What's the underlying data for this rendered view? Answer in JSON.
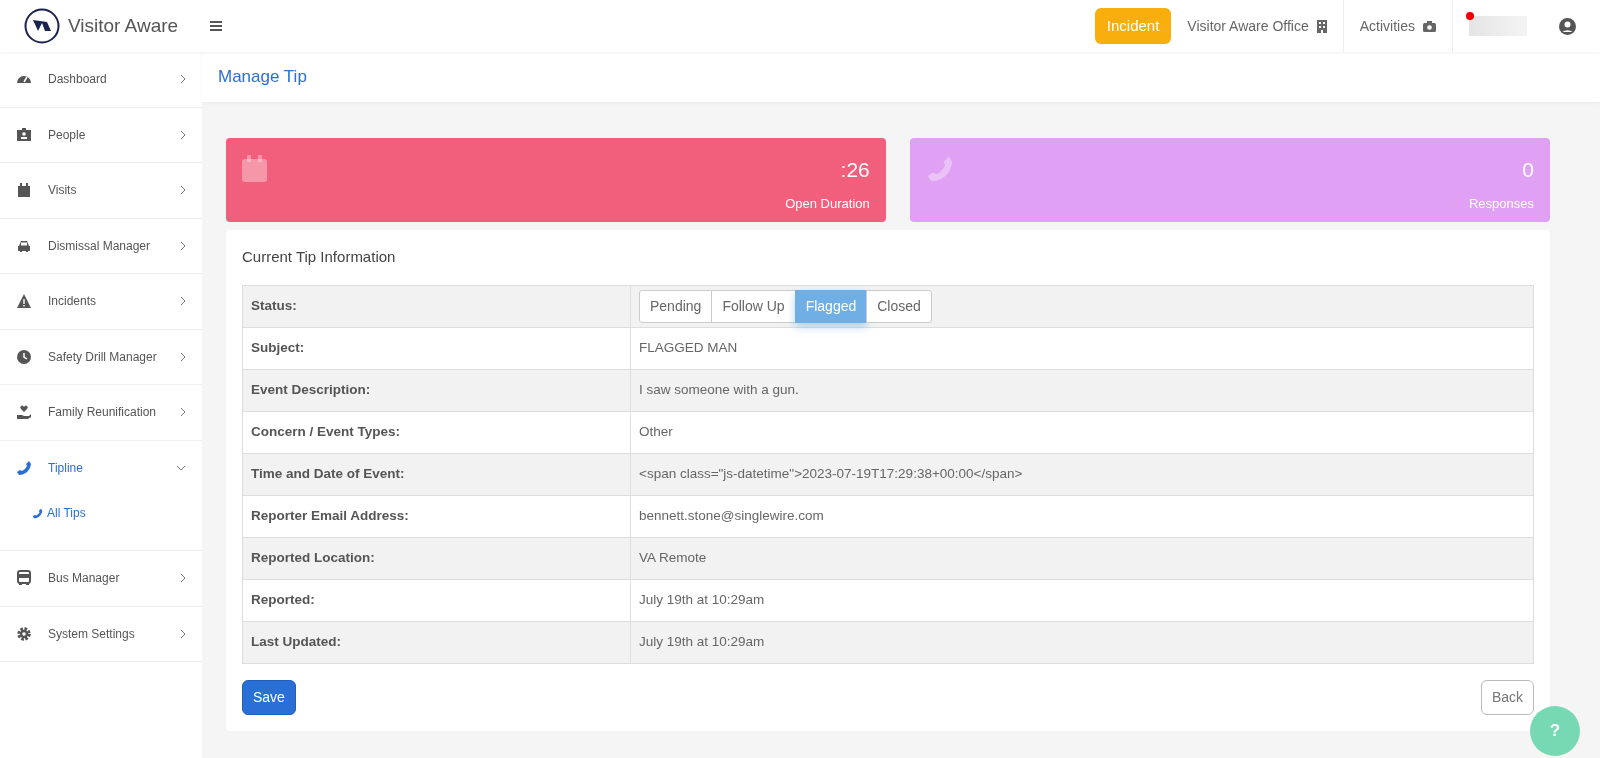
{
  "header": {
    "brand": "Visitor Aware",
    "incident_button": "Incident",
    "office": "Visitor Aware Office",
    "activities": "Activities",
    "notification": true
  },
  "sidebar": {
    "items": [
      {
        "label": "Dashboard",
        "expanded": false,
        "selected": false
      },
      {
        "label": "People",
        "expanded": false,
        "selected": false
      },
      {
        "label": "Visits",
        "expanded": false,
        "selected": false
      },
      {
        "label": "Dismissal Manager",
        "expanded": false,
        "selected": false
      },
      {
        "label": "Incidents",
        "expanded": false,
        "selected": false
      },
      {
        "label": "Safety Drill Manager",
        "expanded": false,
        "selected": false
      },
      {
        "label": "Family Reunification",
        "expanded": false,
        "selected": false
      },
      {
        "label": "Tipline",
        "expanded": true,
        "selected": true,
        "children": [
          {
            "label": "All Tips",
            "selected": true
          }
        ]
      },
      {
        "label": "Bus Manager",
        "expanded": false,
        "selected": false
      },
      {
        "label": "System Settings",
        "expanded": false,
        "selected": false
      }
    ]
  },
  "page_title": "Manage Tip",
  "stats": [
    {
      "value": ":26",
      "label": "Open Duration",
      "color": "#f25f7c"
    },
    {
      "value": "0",
      "label": "Responses",
      "color": "#e0a1f5"
    }
  ],
  "panel": {
    "title": "Current Tip Information",
    "rows": [
      {
        "kind": "status",
        "label": "Status:",
        "options": [
          {
            "label": "Pending",
            "selected": false
          },
          {
            "label": "Follow Up",
            "selected": false
          },
          {
            "label": "Flagged",
            "selected": true
          },
          {
            "label": "Closed",
            "selected": false
          }
        ]
      },
      {
        "kind": "text",
        "label": "Subject:",
        "value": "FLAGGED MAN"
      },
      {
        "kind": "text",
        "label": "Event Description:",
        "value": "I saw someone with a gun."
      },
      {
        "kind": "text",
        "label": "Concern / Event Types:",
        "value": "Other"
      },
      {
        "kind": "text",
        "label": "Time and Date of Event:",
        "value": "<span class=\"js-datetime\">2023-07-19T17:29:38+00:00</span>"
      },
      {
        "kind": "text",
        "label": "Reporter Email Address:",
        "value": "bennett.stone@singlewire.com"
      },
      {
        "kind": "text",
        "label": "Reported Location:",
        "value": "VA Remote"
      },
      {
        "kind": "text",
        "label": "Reported:",
        "value": "July 19th at 10:29am"
      },
      {
        "kind": "text",
        "label": "Last Updated:",
        "value": "July 19th at 10:29am"
      }
    ],
    "save_button": "Save",
    "back_button": "Back"
  },
  "help_button": "?"
}
